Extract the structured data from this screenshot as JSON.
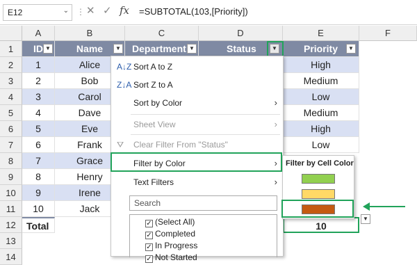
{
  "formula_bar": {
    "name_box": "E12",
    "fx_label": "fx",
    "formula": "=SUBTOTAL(103,[Priority])"
  },
  "columns": [
    "A",
    "B",
    "C",
    "D",
    "E",
    "F"
  ],
  "rows": [
    "1",
    "2",
    "3",
    "4",
    "5",
    "6",
    "7",
    "8",
    "9",
    "10",
    "11",
    "12",
    "13",
    "14"
  ],
  "headers": {
    "id": "ID",
    "name": "Name",
    "department": "Department",
    "status": "Status",
    "priority": "Priority"
  },
  "ids": [
    "1",
    "2",
    "3",
    "4",
    "5",
    "6",
    "7",
    "8",
    "9",
    "10"
  ],
  "names": [
    "Alice",
    "Bob",
    "Carol",
    "Dave",
    "Eve",
    "Frank",
    "Grace",
    "Henry",
    "Irene",
    "Jack"
  ],
  "priorities": [
    "High",
    "Medium",
    "Low",
    "Medium",
    "High",
    "Low"
  ],
  "total": {
    "label": "Total",
    "value": "10"
  },
  "menu": {
    "sort_az": "Sort A to Z",
    "sort_za": "Sort Z to A",
    "sort_color": "Sort by Color",
    "sheet_view": "Sheet View",
    "clear_filter": "Clear Filter From \"Status\"",
    "filter_color": "Filter by Color",
    "text_filters": "Text Filters",
    "search_placeholder": "Search",
    "list_items": [
      "(Select All)",
      "Completed",
      "In Progress",
      "Not Started"
    ]
  },
  "submenu": {
    "title": "Filter by Cell Color",
    "colors": [
      "#92d050",
      "#ffd966",
      "#c55a11"
    ]
  },
  "colors": {
    "accent": "#21a35a",
    "header": "#7f8aa3",
    "band": "#d9e0f3"
  }
}
